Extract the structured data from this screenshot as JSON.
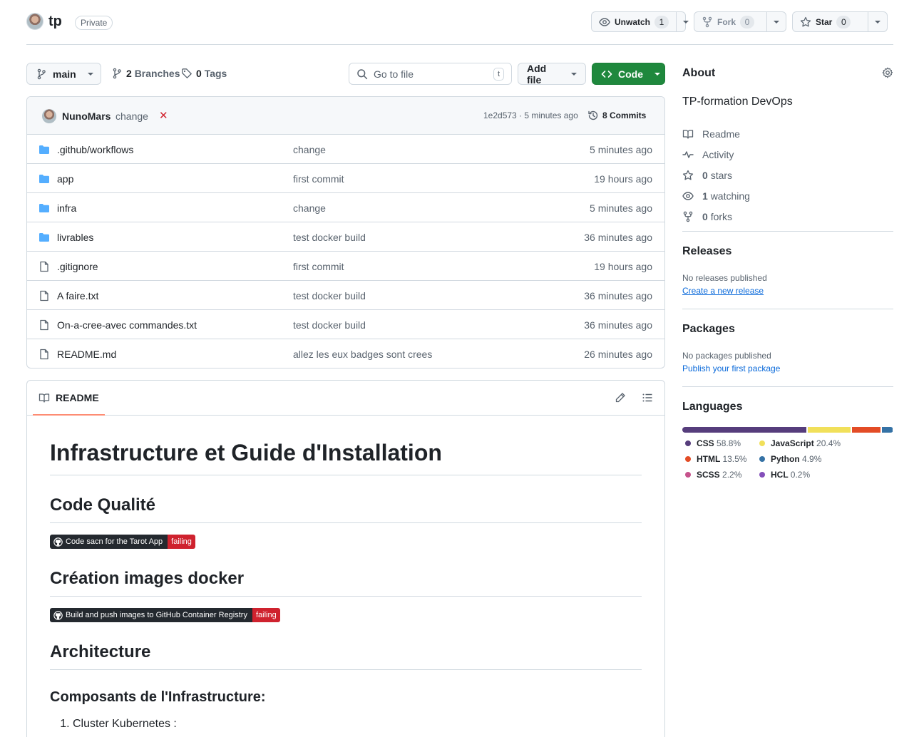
{
  "repo": {
    "name": "tp",
    "visibility": "Private",
    "unwatch_label": "Unwatch",
    "watch_count": "1",
    "fork_label": "Fork",
    "fork_count": "0",
    "star_label": "Star",
    "star_count": "0"
  },
  "toolbar": {
    "branch": "main",
    "branches_count": "2",
    "branches_label": "Branches",
    "tags_count": "0",
    "tags_label": "Tags",
    "search_placeholder": "Go to file",
    "search_shortcut": "t",
    "add_file_label": "Add file",
    "code_label": "Code"
  },
  "latest_commit": {
    "author": "NunoMars",
    "message": "change",
    "status_icon": "x-icon",
    "sha_time": "1e2d573 · 5 minutes ago",
    "commits_label": "8 Commits"
  },
  "files": [
    {
      "type": "folder",
      "name": ".github/workflows",
      "message": "change",
      "time": "5 minutes ago"
    },
    {
      "type": "folder",
      "name": "app",
      "message": "first commit",
      "time": "19 hours ago"
    },
    {
      "type": "folder",
      "name": "infra",
      "message": "change",
      "time": "5 minutes ago"
    },
    {
      "type": "folder",
      "name": "livrables",
      "message": "test docker build",
      "time": "36 minutes ago"
    },
    {
      "type": "file",
      "name": ".gitignore",
      "message": "first commit",
      "time": "19 hours ago"
    },
    {
      "type": "file",
      "name": "A faire.txt",
      "message": "test docker build",
      "time": "36 minutes ago"
    },
    {
      "type": "file",
      "name": "On-a-cree-avec commandes.txt",
      "message": "test docker build",
      "time": "36 minutes ago"
    },
    {
      "type": "file",
      "name": "README.md",
      "message": "allez les eux badges sont crees",
      "time": "26 minutes ago"
    }
  ],
  "readme": {
    "tab_label": "README",
    "h1": "Infrastructure et Guide d'Installation",
    "h2_quality": "Code Qualité",
    "badge1_label": "Code sacn for the Tarot App",
    "badge1_status": "failing",
    "h2_docker": "Création images docker",
    "badge2_label": "Build and push images to GitHub Container Registry",
    "badge2_status": "failing",
    "h2_arch": "Architecture",
    "h3_components": "Composants de l'Infrastructure:",
    "list_item_1": "Cluster Kubernetes :"
  },
  "about": {
    "title": "About",
    "description": "TP-formation DevOps",
    "readme_label": "Readme",
    "activity_label": "Activity",
    "stars_count": "0",
    "stars_label": "stars",
    "watching_count": "1",
    "watching_label": "watching",
    "forks_count": "0",
    "forks_label": "forks"
  },
  "releases": {
    "title": "Releases",
    "empty_text": "No releases published",
    "create_link": "Create a new release"
  },
  "packages": {
    "title": "Packages",
    "empty_text": "No packages published",
    "publish_link": "Publish your first package"
  },
  "languages": {
    "title": "Languages",
    "items": [
      {
        "name": "CSS",
        "percent": "58.8%",
        "value": 58.8,
        "color": "#563d7c"
      },
      {
        "name": "JavaScript",
        "percent": "20.4%",
        "value": 20.4,
        "color": "#f1e05a"
      },
      {
        "name": "HTML",
        "percent": "13.5%",
        "value": 13.5,
        "color": "#e34c26"
      },
      {
        "name": "Python",
        "percent": "4.9%",
        "value": 4.9,
        "color": "#3572A5"
      },
      {
        "name": "SCSS",
        "percent": "2.2%",
        "value": 2.2,
        "color": "#c6538c"
      },
      {
        "name": "HCL",
        "percent": "0.2%",
        "value": 0.2,
        "color": "#844FBA"
      }
    ]
  }
}
